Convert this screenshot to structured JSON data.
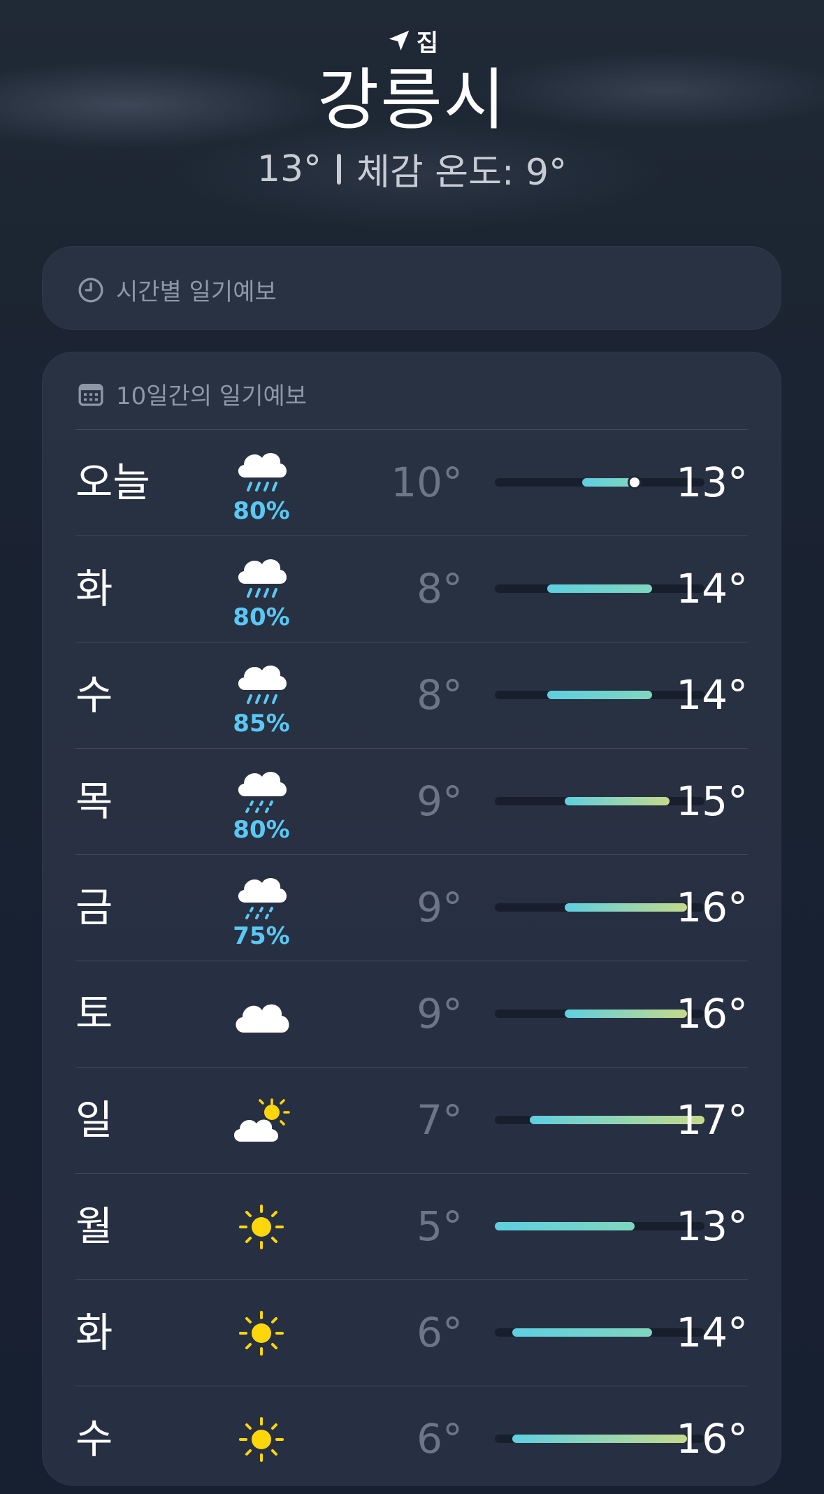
{
  "header": {
    "location_label": "집",
    "city": "강릉시",
    "current_temp": "13°",
    "feels_like": "체감 온도: 9°"
  },
  "hourly_card": {
    "title": "시간별 일기예보"
  },
  "forecast_card": {
    "title": "10일간의 일기예보"
  },
  "forecast": [
    {
      "day": "오늘",
      "icon": "cloud-rain-icon",
      "precip": "80%",
      "low": "10°",
      "high": "13°",
      "range": [
        10,
        13
      ],
      "current": 13
    },
    {
      "day": "화",
      "icon": "cloud-rain-icon",
      "precip": "80%",
      "low": "8°",
      "high": "14°",
      "range": [
        8,
        14
      ]
    },
    {
      "day": "수",
      "icon": "cloud-rain-icon",
      "precip": "85%",
      "low": "8°",
      "high": "14°",
      "range": [
        8,
        14
      ]
    },
    {
      "day": "목",
      "icon": "cloud-drizzle-icon",
      "precip": "80%",
      "low": "9°",
      "high": "15°",
      "range": [
        9,
        15
      ]
    },
    {
      "day": "금",
      "icon": "cloud-drizzle-icon",
      "precip": "75%",
      "low": "9°",
      "high": "16°",
      "range": [
        9,
        16
      ]
    },
    {
      "day": "토",
      "icon": "cloud-icon",
      "precip": "",
      "low": "9°",
      "high": "16°",
      "range": [
        9,
        16
      ]
    },
    {
      "day": "일",
      "icon": "cloud-sun-icon",
      "precip": "",
      "low": "7°",
      "high": "17°",
      "range": [
        7,
        17
      ]
    },
    {
      "day": "월",
      "icon": "sun-icon",
      "precip": "",
      "low": "5°",
      "high": "13°",
      "range": [
        5,
        13
      ]
    },
    {
      "day": "화",
      "icon": "sun-icon",
      "precip": "",
      "low": "6°",
      "high": "14°",
      "range": [
        6,
        14
      ]
    },
    {
      "day": "수",
      "icon": "sun-icon",
      "precip": "",
      "low": "6°",
      "high": "16°",
      "range": [
        6,
        16
      ]
    }
  ],
  "temperature_scale": [
    5,
    17
  ],
  "colors": {
    "precip_text": "#5ac8f5",
    "bar_cool": "#5ecfe0",
    "bar_mid": "#7fd6bf",
    "bar_warm": "#c5d98a",
    "sun": "#ffd60a"
  }
}
